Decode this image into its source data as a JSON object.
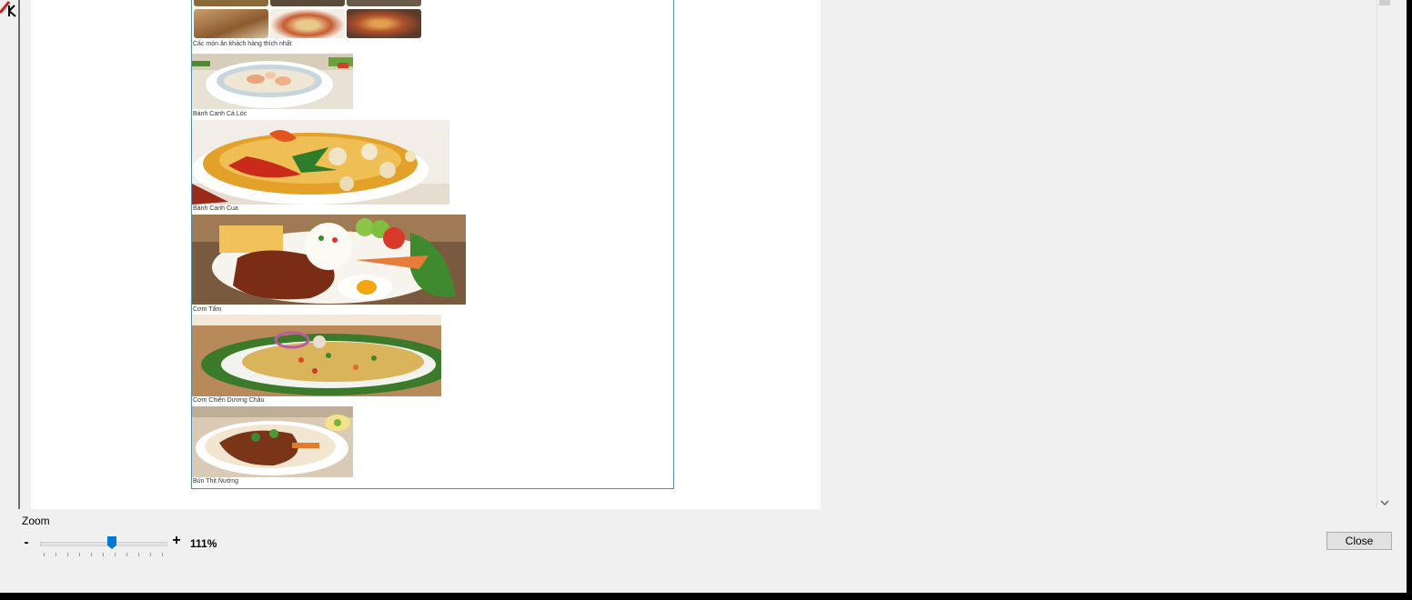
{
  "preview": {
    "top_caption": "Các món ăn khách hàng thích nhất",
    "items": [
      {
        "caption": "Bánh Canh Cá Lóc"
      },
      {
        "caption": "Bánh Canh Cua"
      },
      {
        "caption": "Cơm Tấm"
      },
      {
        "caption": "Cơm Chiên Dương Châu"
      },
      {
        "caption": "Bún Thịt Nướng"
      }
    ]
  },
  "zoom": {
    "label": "Zoom",
    "minus": "-",
    "plus": "+",
    "value_text": "111%",
    "slider_fraction": 0.58
  },
  "actions": {
    "close_label": "Close"
  },
  "icons": {
    "scroll_down": "chevron-down-icon"
  }
}
